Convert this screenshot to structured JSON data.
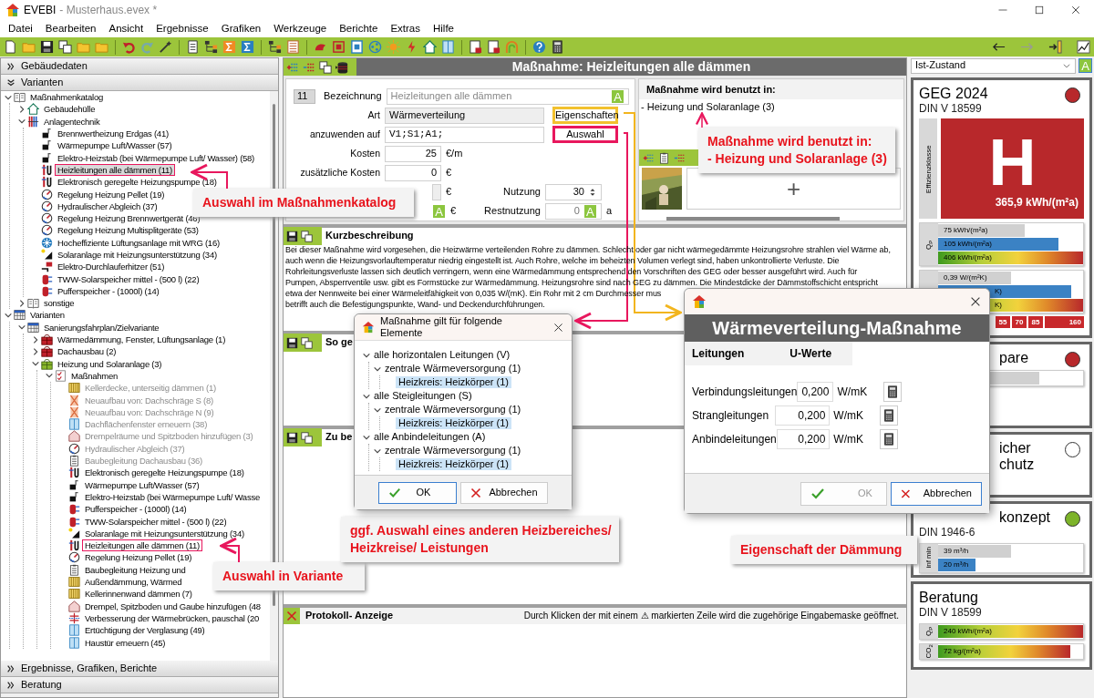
{
  "window": {
    "app_name": "EVEBI",
    "document": "- Musterhaus.evex *"
  },
  "menu": [
    "Datei",
    "Bearbeiten",
    "Ansicht",
    "Ergebnisse",
    "Grafiken",
    "Werkzeuge",
    "Berichte",
    "Extras",
    "Hilfe"
  ],
  "left_panel": {
    "headers_top": [
      {
        "label": "Gebäudedaten",
        "expanded": false
      },
      {
        "label": "Varianten",
        "expanded": true
      }
    ],
    "tree": [
      {
        "label": "Maßnahmenkatalog",
        "kind": "book",
        "expanded": true,
        "children": [
          {
            "label": "Gebäudehülle",
            "kind": "house",
            "expanded": false
          },
          {
            "label": "Anlagentechnik",
            "kind": "pipes",
            "expanded": true,
            "children": [
              {
                "label": "Brennwertheizung Erdgas (41)",
                "kind": "pump"
              },
              {
                "label": "Wärmepumpe Luft/Wasser (57)",
                "kind": "pump"
              },
              {
                "label": "Elektro-Heizstab (bei Wärmepumpe Luft/ Wasser) (58)",
                "kind": "pump"
              },
              {
                "label": "Heizleitungen alle dämmen (11)",
                "kind": "pipe",
                "selected": true,
                "marked": true
              },
              {
                "label": "Elektronisch geregelte Heizungspumpe (18)",
                "kind": "pipe",
                "selected": false,
                "marked": false
              },
              {
                "label": "Regelung Heizung Pellet (19)",
                "kind": "gauge"
              },
              {
                "label": "Hydraulischer Abgleich (37)",
                "kind": "gauge"
              },
              {
                "label": "Regelung Heizung Brennwertgerät (46)",
                "kind": "gauge"
              },
              {
                "label": "Regelung Heizung Multisplitgeräte (53)",
                "kind": "gauge"
              },
              {
                "label": "Hocheffiziente Lüftungsanlage mit WRG (16)",
                "kind": "fan"
              },
              {
                "label": "Solaranlage mit Heizungsunterstützung (34)",
                "kind": "solar"
              },
              {
                "label": "Elektro-Durchlauferhitzer (51)",
                "kind": "heater"
              },
              {
                "label": "TWW-Solarspeicher mittel - (500 l) (22)",
                "kind": "tank"
              },
              {
                "label": "Pufferspeicher - (1000l) (14)",
                "kind": "tank"
              }
            ]
          },
          {
            "label": "sonstige",
            "kind": "book",
            "expanded": false
          }
        ]
      },
      {
        "label": "Varianten",
        "kind": "table",
        "expanded": true,
        "children": [
          {
            "label": "Sanierungsfahrplan/Zielvariante",
            "kind": "table",
            "expanded": true,
            "children": [
              {
                "label": "Wärmedämmung, Fenster, Lüftungsanlage (1)",
                "kind": "package",
                "expanded": false
              },
              {
                "label": "Dachausbau (2)",
                "kind": "package",
                "expanded": false
              },
              {
                "label": "Heizung und Solaranlage (3)",
                "kind": "package-green",
                "expanded": true,
                "children": [
                  {
                    "label": "Maßnahmen",
                    "kind": "checklist",
                    "expanded": true,
                    "children": [
                      {
                        "label": "Kellerdecke, unterseitig dämmen (1)",
                        "kind": "wall",
                        "disabled": true
                      },
                      {
                        "label": "Neuaufbau von: Dachschräge S (8)",
                        "kind": "insulation",
                        "disabled": true
                      },
                      {
                        "label": "Neuaufbau von: Dachschräge N (9)",
                        "kind": "insulation",
                        "disabled": true
                      },
                      {
                        "label": "Dachflächenfenster erneuern (38)",
                        "kind": "window",
                        "disabled": true
                      },
                      {
                        "label": "Drempelräume und Spitzboden hinzufügen (3)",
                        "kind": "roof",
                        "disabled": true
                      },
                      {
                        "label": "Hydraulischer Abgleich (37)",
                        "kind": "gauge",
                        "disabled": true
                      },
                      {
                        "label": "Baubegleitung Dachausbau (36)",
                        "kind": "clipboard",
                        "disabled": true
                      },
                      {
                        "label": "Elektronisch geregelte Heizungspumpe (18)",
                        "kind": "pipe",
                        "disabled": false
                      },
                      {
                        "label": "Wärmepumpe Luft/Wasser (57)",
                        "kind": "pump",
                        "disabled": false
                      },
                      {
                        "label": "Elektro-Heizstab (bei Wärmepumpe Luft/ Wasse",
                        "kind": "pump",
                        "disabled": false
                      },
                      {
                        "label": "Pufferspeicher - (1000l) (14)",
                        "kind": "tank",
                        "disabled": false
                      },
                      {
                        "label": "TWW-Solarspeicher mittel - (500 l) (22)",
                        "kind": "tank",
                        "disabled": false
                      },
                      {
                        "label": "Solaranlage mit Heizungsunterstützung (34)",
                        "kind": "solar",
                        "disabled": false
                      },
                      {
                        "label": "Heizleitungen alle dämmen (11)",
                        "kind": "pipe",
                        "disabled": false,
                        "marked": true
                      },
                      {
                        "label": "Regelung Heizung Pellet (19)",
                        "kind": "gauge",
                        "disabled": false
                      },
                      {
                        "label": "Baubegleitung Heizung und",
                        "kind": "clipboard",
                        "disabled": false
                      },
                      {
                        "label": "Außendämmung, Wärmed",
                        "kind": "wall",
                        "disabled": false
                      },
                      {
                        "label": "Kellerinnenwand dämmen (7)",
                        "kind": "wall",
                        "disabled": false
                      },
                      {
                        "label": "Drempel, Spitzboden und Gaube hinzufügen (48",
                        "kind": "roof",
                        "disabled": false
                      },
                      {
                        "label": "Verbesserung der Wärmebrücken, pauschal (20",
                        "kind": "bridge",
                        "disabled": false
                      },
                      {
                        "label": "Ertüchtigung der Verglasung (49)",
                        "kind": "window",
                        "disabled": false
                      },
                      {
                        "label": "Haustür erneuern (45)",
                        "kind": "window",
                        "disabled": false
                      }
                    ]
                  }
                ]
              }
            ]
          }
        ]
      }
    ],
    "headers_bottom": [
      {
        "label": "Ergebnisse, Grafiken, Berichte",
        "expanded": false
      },
      {
        "label": "Beratung",
        "expanded": false
      }
    ]
  },
  "measure": {
    "title": "Maßnahme: Heizleitungen alle dämmen",
    "number": "11",
    "name_label": "Bezeichnung",
    "name_value": "Heizleitungen alle dämmen",
    "auto_button": "A",
    "type_label": "Art",
    "type_value": "Wärmeverteilung",
    "properties_button": "Eigenschaften",
    "apply_label": "anzuwenden auf",
    "apply_value": "V1;S1;A1;",
    "select_button": "Auswahl",
    "cost_rows": [
      {
        "label": "Kosten",
        "value": "25",
        "unit": "€/m"
      },
      {
        "label": "zusätzliche Kosten",
        "value": "0",
        "unit": "€"
      },
      {
        "unit": "€"
      },
      {
        "unit": "€",
        "auto_button": "A"
      }
    ],
    "usage": {
      "label": "Nutzung",
      "value": "30"
    },
    "remaining": {
      "label": "Restnutzung",
      "value": "0",
      "auto_button": "A",
      "unit": "a"
    }
  },
  "used_in": {
    "title": "Maßnahme wird benutzt in:",
    "items": [
      "- Heizung und Solaranlage (3)"
    ],
    "add_symbol": "+"
  },
  "description": {
    "title": "Kurzbeschreibung",
    "lines": [
      "Bei dieser Maßnahme wird vorgesehen, die Heizwärme verteilenden Rohre zu dämmen. Schlecht oder gar nicht wärmegedämmte Heizungsrohre strahlen viel Wärme ab,",
      "auch wenn die Heizungsvorlauftemperatur niedrig eingestellt ist. Auch Rohre, welche im beheizten Volumen verlegt sind, haben unkontrollierte Verluste. Die",
      "Rohrleitungsverluste lassen sich deutlich verringern, wenn eine Wärmedämmung entsprechend den Vorschriften des GEG oder besser ausgeführt wird. Auch für",
      "Pumpen, Absperrventile usw. gibt es Formstücke zur Wärmedämmung. Heizungsrohre sind nach GEG zu dämmen. Die Mindestdicke der Dämmstoffschicht entspricht",
      "etwa der Nennweite bei einer Wärmeleitfähigkeit von 0,035 W/(mK). Ein Rohr mit 2 cm Durchmesser mus",
      "betrifft auch die Befestigungspunkte, Wand- und Deckendurchführungen."
    ]
  },
  "sections": [
    {
      "title": "So ge"
    },
    {
      "title": "Zu be"
    }
  ],
  "log": {
    "title": "Protokoll- Anzeige",
    "hint": "Durch Klicken der mit einem ⚠ markierten Zeile wird die zugehörige Eingabemaske geöffnet."
  },
  "element_dialog": {
    "title": "Maßnahme gilt für folgende Elemente",
    "tree": [
      {
        "label": "alle horizontalen Leitungen (V)",
        "expanded": true,
        "children": [
          {
            "label": "zentrale Wärmeversorgung (1)",
            "expanded": true,
            "children": [
              {
                "label": "Heizkreis: Heizkörper (1)",
                "selected": true
              }
            ]
          }
        ]
      },
      {
        "label": "alle Steigleitungen (S)",
        "expanded": true,
        "children": [
          {
            "label": "zentrale Wärmeversorgung (1)",
            "expanded": true,
            "children": [
              {
                "label": "Heizkreis: Heizkörper (1)",
                "selected": true
              }
            ]
          }
        ]
      },
      {
        "label": "alle Anbindeleitungen (A)",
        "expanded": true,
        "children": [
          {
            "label": "zentrale Wärmeversorgung (1)",
            "expanded": true,
            "children": [
              {
                "label": "Heizkreis: Heizkörper (1)",
                "selected": true
              }
            ]
          }
        ]
      }
    ],
    "ok": "OK",
    "cancel": "Abbrechen"
  },
  "property_dialog": {
    "heading": "Wärmeverteilung-Maßnahme",
    "columns": [
      "Leitungen",
      "U-Werte"
    ],
    "rows": [
      {
        "label": "Verbindungsleitungen",
        "value": "0,200",
        "unit": "W/mK"
      },
      {
        "label": "Strangleitungen",
        "value": "0,200",
        "unit": "W/mK"
      },
      {
        "label": "Anbindeleitungen",
        "value": "0,200",
        "unit": "W/mK"
      }
    ],
    "ok": {
      "label": "OK",
      "disabled": true
    },
    "cancel": "Abbrechen"
  },
  "right_panel": {
    "scenario": "Ist-Zustand",
    "auto_button": "A",
    "cards": [
      {
        "kind": "rating",
        "title": "GEG 2024",
        "subtitle": "DIN V 18599",
        "color": "#b8282b",
        "class_label": "Effizienzklasse",
        "class": "H",
        "value": "365,9 kWh/(m²a)",
        "bar_groups": [
          {
            "label": "Q$_{P}$",
            "bars": [
              {
                "text": "75 kWh/(m²a)",
                "kind": "grey",
                "level": 0.6
              },
              {
                "text": "105 kWh/(m²a)",
                "kind": "blue",
                "level": 0.83
              },
              {
                "text": "406 kWh/(m²a)",
                "kind": "gradient",
                "level": 1
              }
            ]
          },
          {
            "bars": [
              {
                "text": "0,39 W/(m²K)",
                "kind": "grey",
                "level": 0.5
              },
              {
                "text": "K)",
                "kind": "blue",
                "level": 0.92
              },
              {
                "text": "K)",
                "kind": "gradient",
                "level": 1
              }
            ],
            "scale": [
              "55",
              "70",
              "85",
              "160"
            ]
          }
        ]
      },
      {
        "kind": "partial",
        "title_lines": [
          "pare"
        ],
        "color": "#b8282b",
        "bar_groups": [
          {
            "bars": [
              {
                "kind": "grey",
                "level": 0.7
              }
            ]
          }
        ]
      },
      {
        "kind": "partial",
        "title_lines": [
          "icher",
          "chutz"
        ],
        "color": "#ffffff"
      },
      {
        "kind": "partial",
        "title_lines": [
          "konzept"
        ],
        "subtitle": "DIN 1946-6",
        "color": "#7db42a",
        "bar_groups": [
          {
            "label": "inf min",
            "bars": [
              {
                "text": "39 m³/h",
                "kind": "grey",
                "level": 0.5
              },
              {
                "text": "20 m³/h",
                "kind": "blue",
                "level": 0.26
              }
            ]
          }
        ]
      },
      {
        "kind": "plain",
        "title": "Beratung",
        "subtitle": "DIN V 18599",
        "bar_groups": [
          {
            "label": "Q$_{P}$",
            "bars": [
              {
                "text": "240 kWh/(m²a)",
                "kind": "gradient",
                "level": 1
              }
            ]
          },
          {
            "label": "CO$_{2}$",
            "bars": [
              {
                "text": "72 kg/(m²a)",
                "kind": "gradient",
                "level": 0.91
              }
            ]
          }
        ]
      }
    ]
  },
  "callouts": [
    {
      "lines": [
        "Auswahl im Maßnahmenkatalog"
      ]
    },
    {
      "lines": [
        "Auswahl in Variante"
      ]
    },
    {
      "lines": [
        "Maßnahme wird benutzt in:",
        "- Heizung und Solaranlage (3)"
      ]
    },
    {
      "lines": [
        "ggf. Auswahl eines anderen Heizbereiches/",
        "Heizkreise/ Leistungen"
      ]
    },
    {
      "lines": [
        "Eigenschaft der Dämmung"
      ]
    }
  ]
}
